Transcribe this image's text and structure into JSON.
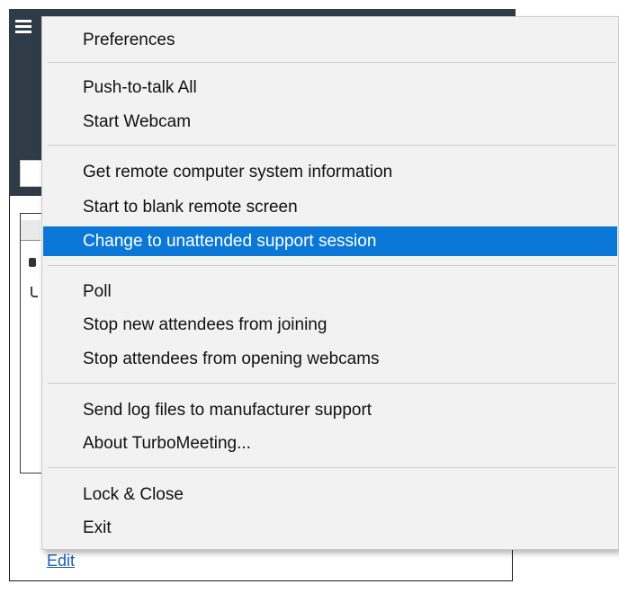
{
  "menu": {
    "items": [
      {
        "label": "Preferences"
      },
      {
        "label": "Push-to-talk All"
      },
      {
        "label": "Start Webcam"
      },
      {
        "label": "Get remote computer system information"
      },
      {
        "label": "Start to blank remote screen"
      },
      {
        "label": "Change to unattended support session",
        "highlighted": true
      },
      {
        "label": "Poll"
      },
      {
        "label": "Stop new attendees from joining"
      },
      {
        "label": "Stop attendees from opening webcams"
      },
      {
        "label": "Send log files to manufacturer support"
      },
      {
        "label": "About TurboMeeting..."
      },
      {
        "label": "Lock & Close"
      },
      {
        "label": "Exit"
      }
    ]
  },
  "background": {
    "edit_link": "Edit",
    "hamburger_icon": "hamburger-icon"
  },
  "colors": {
    "highlight": "#0b78d7",
    "menu_background": "#f2f2f2",
    "titlebar": "#2f3b47",
    "link": "#1a5fb4"
  }
}
